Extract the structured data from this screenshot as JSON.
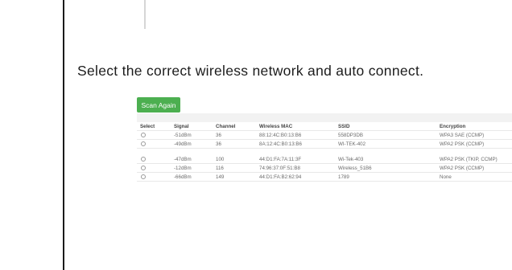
{
  "instruction": "Select the correct wireless network and auto connect.",
  "scan_button": {
    "label": "Scan Again",
    "color": "#4caf50"
  },
  "header_bg": "#f2f2f2",
  "columns": [
    "Select",
    "Signal",
    "Channel",
    "Wireless MAC",
    "SSID",
    "Encryption"
  ],
  "rows_group1": [
    {
      "signal": "-51dBm",
      "channel": "36",
      "mac": "88:12:4C:B0:13:B6",
      "ssid": "558DP3DB",
      "encryption": "WPA3 SAE (CCMP)"
    },
    {
      "signal": "-49dBm",
      "channel": "36",
      "mac": "8A:12:4C:B0:13:B6",
      "ssid": "WI-TEK-402",
      "encryption": "WPA2 PSK (CCMP)"
    }
  ],
  "rows_group2": [
    {
      "signal": "-47dBm",
      "channel": "100",
      "mac": "44:D1:FA:7A:11:3F",
      "ssid": "Wi-Tek-403",
      "encryption": "WPA2 PSK (TKIP, CCMP)"
    },
    {
      "signal": "-12dBm",
      "channel": "116",
      "mac": "74:96:37:0F:51:B8",
      "ssid": "Wireless_51B6",
      "encryption": "WPA2 PSK (CCMP)"
    },
    {
      "signal": "-66dBm",
      "channel": "149",
      "mac": "44:D1:FA:B2:62:94",
      "ssid": "1789",
      "encryption": "None"
    }
  ]
}
